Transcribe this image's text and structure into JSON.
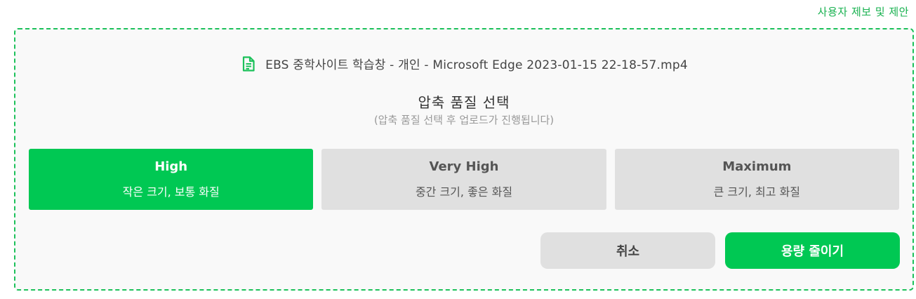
{
  "header": {
    "feedback_link": "사용자 제보 및 제안"
  },
  "file": {
    "icon": "document-icon",
    "name": "EBS 중학사이트 학습창 - 개인 - Microsoft Edge 2023-01-15 22-18-57.mp4"
  },
  "quality": {
    "title": "압축 품질 선택",
    "subtitle": "(압축 품질 선택 후 업로드가 진행됩니다)",
    "selected_index": 0,
    "options": [
      {
        "title": "High",
        "description": "작은 크기, 보통 화질"
      },
      {
        "title": "Very High",
        "description": "중간 크기, 좋은 화질"
      },
      {
        "title": "Maximum",
        "description": "큰 크기, 최고 화질"
      }
    ]
  },
  "actions": {
    "cancel_label": "취소",
    "confirm_label": "용량 줄이기"
  },
  "colors": {
    "accent": "#00c853",
    "border": "#1cc15a",
    "option_bg": "#e0e0e0"
  }
}
